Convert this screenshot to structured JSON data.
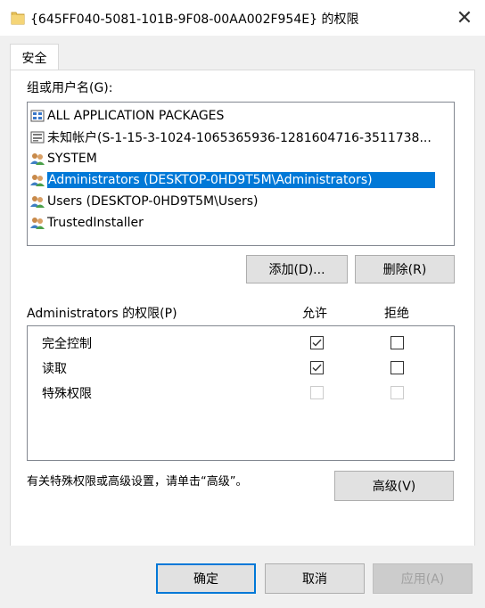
{
  "window": {
    "title": "{645FF040-5081-101B-9F08-00AA002F954E} 的权限",
    "close_glyph": "✕"
  },
  "tabs": [
    {
      "label": "安全"
    }
  ],
  "groups": {
    "label": "组或用户名(G):",
    "items": [
      {
        "label": "ALL APPLICATION PACKAGES",
        "icon": "app-packages-icon"
      },
      {
        "label": "未知帐户(S-1-15-3-1024-1065365936-1281604716-3511738...",
        "icon": "unknown-account-icon"
      },
      {
        "label": "SYSTEM",
        "icon": "user-group-icon"
      },
      {
        "label": "Administrators (DESKTOP-0HD9T5M\\Administrators)",
        "icon": "user-group-icon",
        "selected": true
      },
      {
        "label": "Users (DESKTOP-0HD9T5M\\Users)",
        "icon": "user-group-icon"
      },
      {
        "label": "TrustedInstaller",
        "icon": "user-group-icon"
      }
    ]
  },
  "buttons": {
    "add": "添加(D)...",
    "remove": "删除(R)",
    "advanced": "高级(V)",
    "ok": "确定",
    "cancel": "取消",
    "apply": "应用(A)"
  },
  "permissions": {
    "label": "Administrators 的权限(P)",
    "allow_header": "允许",
    "deny_header": "拒绝",
    "rows": [
      {
        "name": "完全控制",
        "allow": true,
        "deny": false,
        "enabled": true
      },
      {
        "name": "读取",
        "allow": true,
        "deny": false,
        "enabled": true
      },
      {
        "name": "特殊权限",
        "allow": false,
        "deny": false,
        "enabled": false
      }
    ]
  },
  "advanced_hint": "有关特殊权限或高级设置，请单击“高级”。",
  "colors": {
    "selection": "#0078d7",
    "dialog_bg": "#f0f0f0",
    "button_bg": "#e1e1e1"
  }
}
